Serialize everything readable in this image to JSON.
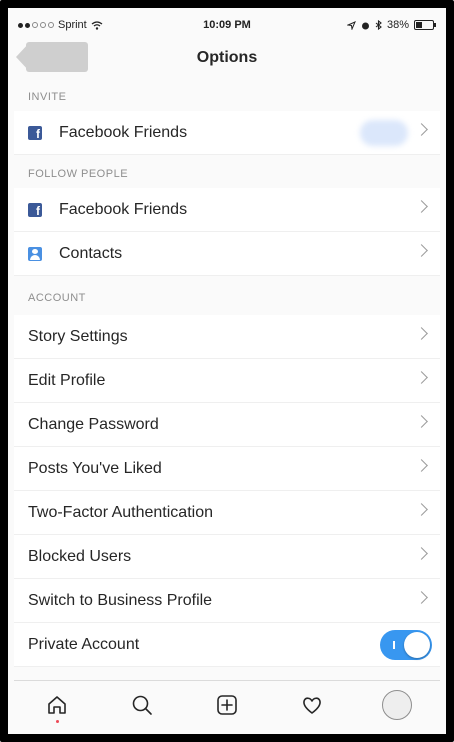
{
  "status_bar": {
    "carrier": "Sprint",
    "time": "10:09 PM",
    "battery": "38%"
  },
  "nav": {
    "title": "Options"
  },
  "sections": {
    "invite": {
      "header": "INVITE",
      "facebook_friends": "Facebook Friends"
    },
    "follow": {
      "header": "FOLLOW PEOPLE",
      "facebook_friends": "Facebook Friends",
      "contacts": "Contacts"
    },
    "account": {
      "header": "ACCOUNT",
      "items": [
        "Story Settings",
        "Edit Profile",
        "Change Password",
        "Posts You've Liked",
        "Two-Factor Authentication",
        "Blocked Users",
        "Switch to Business Profile",
        "Private Account"
      ]
    }
  },
  "private_account_enabled": true,
  "colors": {
    "accent": "#3897f0",
    "facebook": "#3b5998",
    "contacts": "#4a90e2"
  },
  "tabs": [
    "home-icon",
    "search-icon",
    "add-post-icon",
    "activity-heart-icon",
    "profile-avatar"
  ]
}
